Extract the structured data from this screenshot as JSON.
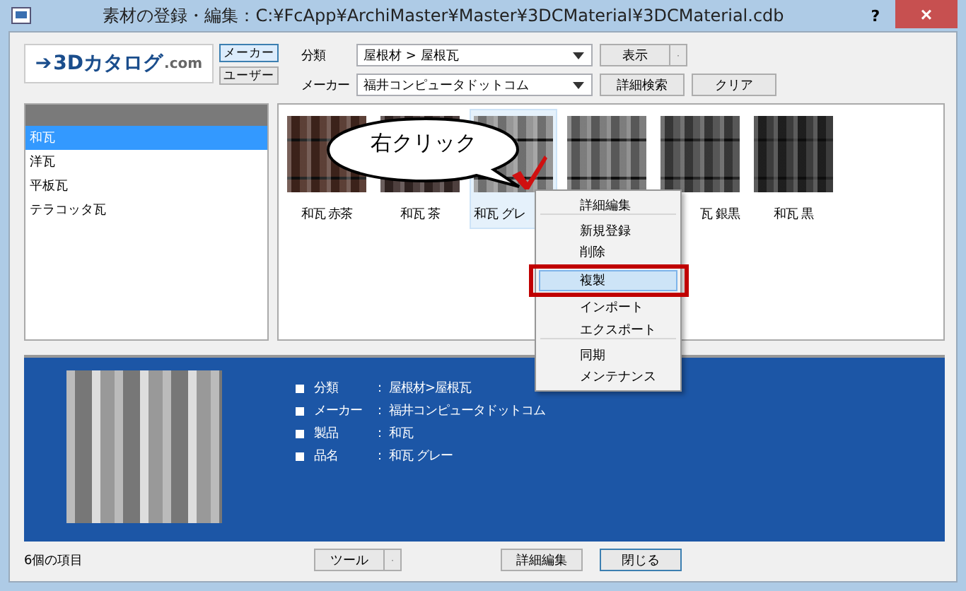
{
  "window": {
    "title": "素材の登録・編集：C:¥FcApp¥ArchiMaster¥Master¥3DCMaterial¥3DCMaterial.cdb",
    "help": "?",
    "close": "×"
  },
  "logo": {
    "arrow": "➔",
    "brand": "3Dカタログ",
    "suffix": ".com"
  },
  "source_buttons": [
    {
      "label": "メーカー",
      "selected": true
    },
    {
      "label": "ユーザー",
      "selected": false
    }
  ],
  "filters": [
    {
      "label": "分類",
      "value": "屋根材 > 屋根瓦"
    },
    {
      "label": "メーカー",
      "value": "福井コンピュータドットコム"
    }
  ],
  "filter_buttons": [
    {
      "label": "表示",
      "kind": "split"
    },
    {
      "label": "詳細検索",
      "kind": "plain"
    },
    {
      "label": "クリア",
      "kind": "plain"
    }
  ],
  "categories": [
    {
      "label": "和瓦",
      "selected": true
    },
    {
      "label": "洋瓦",
      "selected": false
    },
    {
      "label": "平板瓦",
      "selected": false
    },
    {
      "label": "テラコッタ瓦",
      "selected": false
    }
  ],
  "materials": [
    {
      "label": "和瓦 赤茶",
      "kind": "whole",
      "color": "#4a2a20",
      "selected": false
    },
    {
      "label": "和瓦 茶",
      "kind": "whole",
      "color": "#3a2a28",
      "selected": false
    },
    {
      "label": "和瓦 グレ",
      "kind": "cut_end",
      "color": "#8a8a8a",
      "selected": true
    },
    {
      "color": "#6e6e6e",
      "selected": false
    },
    {
      "label": "瓦 銀黒",
      "kind": "cut_start",
      "color": "#444444",
      "selected": false
    },
    {
      "label": "和瓦 黒",
      "kind": "whole",
      "color": "#262626",
      "selected": false
    }
  ],
  "callout": {
    "text": "右クリック"
  },
  "context_menu": [
    {
      "label": "詳細編集",
      "selected": false,
      "separator_after": true
    },
    {
      "label": "新規登録",
      "selected": false,
      "separator_after": false
    },
    {
      "label": "削除",
      "selected": false,
      "separator_after": false
    },
    {
      "label": "複製",
      "selected": true,
      "separator_after": false
    },
    {
      "label": "インポート",
      "selected": false,
      "separator_after": false
    },
    {
      "label": "エクスポート",
      "selected": false,
      "separator_after": true
    },
    {
      "label": "同期",
      "selected": false,
      "separator_after": false
    },
    {
      "label": "メンテナンス",
      "selected": false,
      "separator_after": false
    }
  ],
  "details": [
    {
      "key": "分類",
      "sep": "：",
      "value": "屋根材>屋根瓦"
    },
    {
      "key": "メーカー",
      "sep": "：",
      "value": "福井コンピュータドットコム"
    },
    {
      "key": "製品",
      "sep": "：",
      "value": "和瓦"
    },
    {
      "key": "品名",
      "sep": "：",
      "value": "和瓦 グレー"
    }
  ],
  "status": "6個の項目",
  "bottom_buttons": [
    {
      "label": "ツール",
      "kind": "split"
    },
    {
      "label": "詳細編集",
      "kind": "plain"
    },
    {
      "label": "閉じる",
      "kind": "default"
    }
  ]
}
